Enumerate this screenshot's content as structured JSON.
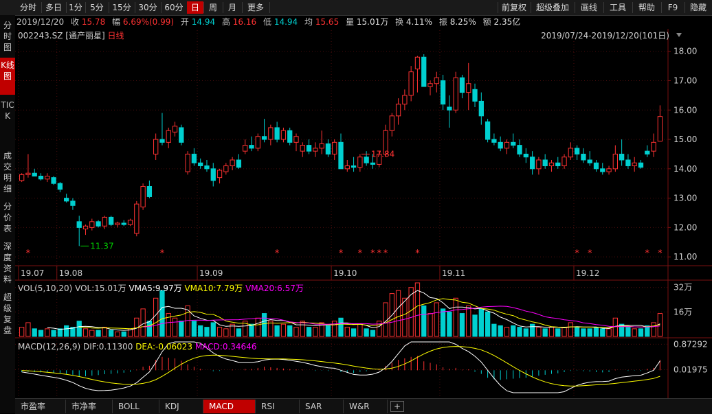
{
  "toolbar": {
    "periods": [
      "分时",
      "多日",
      "1分",
      "5分",
      "15分",
      "30分",
      "60分",
      "日",
      "周",
      "月",
      "更多"
    ],
    "active_period": "日",
    "right": [
      "前复权",
      "超级叠加",
      "画线",
      "工具",
      "帮助",
      "F9",
      "隐藏"
    ]
  },
  "info": {
    "date": "2019/12/20",
    "close_label": "收",
    "close": "15.78",
    "change_label": "幅",
    "change": "6.69%(0.99)",
    "open_label": "开",
    "open": "14.94",
    "high_label": "高",
    "high": "16.16",
    "low_label": "低",
    "low": "14.94",
    "avg_label": "均",
    "avg": "15.65",
    "vol_label": "量",
    "vol": "15.01万",
    "turnover_label": "换",
    "turnover": "4.11%",
    "amplitude_label": "振",
    "amplitude": "8.25%",
    "amount_label": "额",
    "amount": "2.35亿"
  },
  "sidebar": [
    "分时图",
    "K线图",
    "TICK",
    "成交明细",
    "分价表",
    "深度资料",
    "超级复盘"
  ],
  "sidebar_active": "K线图",
  "chart_header": {
    "code": "002243.SZ",
    "name": "[通产丽星]",
    "period": "日线",
    "range": "2019/07/24-2019/12/20(101日)"
  },
  "volume_header": {
    "title": "VOL(5,10,20)",
    "vol": "VOL:15.01万",
    "vma5": "VMA5:9.97万",
    "vma10": "VMA10:7.79万",
    "vma20": "VMA20:6.57万"
  },
  "macd_header": {
    "title": "MACD(12,26,9)",
    "dif": "DIF:0.11300",
    "dea": "DEA:-0.06023",
    "macd": "MACD:0.34646"
  },
  "bottom_tabs": [
    "市盈率",
    "市净率",
    "BOLL",
    "KDJ",
    "MACD",
    "RSI",
    "SAR",
    "W&R"
  ],
  "bottom_active": "MACD",
  "colors": {
    "up": "#ff3232",
    "down": "#00d0d0",
    "vma5": "#ffffff",
    "vma10": "#ffff00",
    "vma20": "#ff00ff",
    "dif": "#ffffff",
    "dea": "#ffff00"
  },
  "chart_data": {
    "type": "candlestick",
    "price_axis": {
      "ticks": [
        "18.00",
        "17.00",
        "16.00",
        "15.00",
        "14.00",
        "13.00",
        "12.00",
        "11.00"
      ],
      "ylim": [
        10.7,
        18.25
      ]
    },
    "x_ticks": [
      {
        "label": "19.07",
        "i": 0
      },
      {
        "label": "19.08",
        "i": 6
      },
      {
        "label": "19.09",
        "i": 28
      },
      {
        "label": "19.10",
        "i": 49
      },
      {
        "label": "19.11",
        "i": 66
      },
      {
        "label": "19.12",
        "i": 87
      }
    ],
    "annotations": [
      {
        "label": "17.84",
        "i": 53
      },
      {
        "label": "11.37",
        "i": 9
      }
    ],
    "star_indices": [
      1,
      22,
      40,
      50,
      53,
      55,
      56,
      57,
      62,
      87,
      89,
      98,
      100
    ],
    "volume_axis": {
      "ticks": [
        "32万",
        "16万"
      ],
      "max": 35
    },
    "macd_axis": {
      "ticks": [
        "0.87292",
        "0.01975"
      ],
      "range": [
        -0.75,
        0.95
      ]
    },
    "candles": [
      [
        13.6,
        13.85,
        13.55,
        13.8
      ],
      [
        13.8,
        14.5,
        13.7,
        13.85
      ],
      [
        13.85,
        14.0,
        13.75,
        13.75
      ],
      [
        13.75,
        13.85,
        13.6,
        13.65
      ],
      [
        13.65,
        13.85,
        13.55,
        13.75
      ],
      [
        13.7,
        13.75,
        13.45,
        13.5
      ],
      [
        13.5,
        13.55,
        13.2,
        13.3
      ],
      [
        13.0,
        13.15,
        12.85,
        12.9
      ],
      [
        12.9,
        13.0,
        12.6,
        12.75
      ],
      [
        12.2,
        12.4,
        11.37,
        12.0
      ],
      [
        11.95,
        12.1,
        11.75,
        12.05
      ],
      [
        12.0,
        12.3,
        11.9,
        12.2
      ],
      [
        12.2,
        12.25,
        12.0,
        12.05
      ],
      [
        12.05,
        12.4,
        11.95,
        12.35
      ],
      [
        12.35,
        12.4,
        12.05,
        12.1
      ],
      [
        12.1,
        12.2,
        12.0,
        12.15
      ],
      [
        12.15,
        12.25,
        12.05,
        12.1
      ],
      [
        12.1,
        12.3,
        12.05,
        12.25
      ],
      [
        11.8,
        12.9,
        11.7,
        12.8
      ],
      [
        12.7,
        13.5,
        12.6,
        13.4
      ],
      [
        13.4,
        13.6,
        13.0,
        13.05
      ],
      [
        14.5,
        15.2,
        14.3,
        15.0
      ],
      [
        15.0,
        15.9,
        14.8,
        14.9
      ],
      [
        14.9,
        15.4,
        14.7,
        15.3
      ],
      [
        15.25,
        15.6,
        15.1,
        15.45
      ],
      [
        15.4,
        15.5,
        14.8,
        14.9
      ],
      [
        13.9,
        14.6,
        13.8,
        14.5
      ],
      [
        14.5,
        14.7,
        14.1,
        14.2
      ],
      [
        14.2,
        14.35,
        14.0,
        14.1
      ],
      [
        14.1,
        14.3,
        13.9,
        14.0
      ],
      [
        14.0,
        14.2,
        13.4,
        13.6
      ],
      [
        13.7,
        14.0,
        13.5,
        13.95
      ],
      [
        13.9,
        14.2,
        13.8,
        14.1
      ],
      [
        14.1,
        14.4,
        13.95,
        14.3
      ],
      [
        14.3,
        14.5,
        14.0,
        14.05
      ],
      [
        14.6,
        15.0,
        14.5,
        14.8
      ],
      [
        14.8,
        15.1,
        14.6,
        14.7
      ],
      [
        14.7,
        15.2,
        14.6,
        15.1
      ],
      [
        15.1,
        15.7,
        14.9,
        15.0
      ],
      [
        15.0,
        15.5,
        14.8,
        15.4
      ],
      [
        15.4,
        15.6,
        14.9,
        15.0
      ],
      [
        15.0,
        15.4,
        14.9,
        15.3
      ],
      [
        15.3,
        15.4,
        14.8,
        14.9
      ],
      [
        14.9,
        15.2,
        14.6,
        15.1
      ],
      [
        14.6,
        14.9,
        14.4,
        14.8
      ],
      [
        14.8,
        15.0,
        14.5,
        14.6
      ],
      [
        14.6,
        14.9,
        14.4,
        14.7
      ],
      [
        14.7,
        15.3,
        14.5,
        14.85
      ],
      [
        14.85,
        15.0,
        14.4,
        14.5
      ],
      [
        14.5,
        15.0,
        14.3,
        14.9
      ],
      [
        14.9,
        15.2,
        14.4,
        14.0
      ],
      [
        14.0,
        14.3,
        13.9,
        14.1
      ],
      [
        14.1,
        14.4,
        13.9,
        14.05
      ],
      [
        14.05,
        14.5,
        13.9,
        14.4
      ],
      [
        14.4,
        14.6,
        14.1,
        14.2
      ],
      [
        14.2,
        14.5,
        14.0,
        14.15
      ],
      [
        14.15,
        14.6,
        14.05,
        14.5
      ],
      [
        14.5,
        15.5,
        14.4,
        15.3
      ],
      [
        15.3,
        15.9,
        15.1,
        15.8
      ],
      [
        15.8,
        16.4,
        15.5,
        16.2
      ],
      [
        16.2,
        16.7,
        16.0,
        16.5
      ],
      [
        16.5,
        17.5,
        16.3,
        17.3
      ],
      [
        17.4,
        17.84,
        16.6,
        17.8
      ],
      [
        17.8,
        17.9,
        16.8,
        16.8
      ],
      [
        16.8,
        17.0,
        16.5,
        16.9
      ],
      [
        16.9,
        17.3,
        16.6,
        17.1
      ],
      [
        17.0,
        17.2,
        16.0,
        16.2
      ],
      [
        16.1,
        16.5,
        15.4,
        16.0
      ],
      [
        16.0,
        17.3,
        15.9,
        17.1
      ],
      [
        17.1,
        17.2,
        16.4,
        16.6
      ],
      [
        16.6,
        17.6,
        16.0,
        16.9
      ],
      [
        16.7,
        16.9,
        16.1,
        16.3
      ],
      [
        16.3,
        16.6,
        15.5,
        15.8
      ],
      [
        15.6,
        15.7,
        14.9,
        15.0
      ],
      [
        15.0,
        15.2,
        14.8,
        14.9
      ],
      [
        14.9,
        15.1,
        14.6,
        14.7
      ],
      [
        14.7,
        15.0,
        14.5,
        14.9
      ],
      [
        14.9,
        15.2,
        14.7,
        14.8
      ],
      [
        14.8,
        15.0,
        14.4,
        14.5
      ],
      [
        14.5,
        14.7,
        14.2,
        14.4
      ],
      [
        14.4,
        14.6,
        13.8,
        14.0
      ],
      [
        14.0,
        14.4,
        13.8,
        14.3
      ],
      [
        14.3,
        14.5,
        14.0,
        14.1
      ],
      [
        14.1,
        14.3,
        13.9,
        14.2
      ],
      [
        14.2,
        14.4,
        14.0,
        14.1
      ],
      [
        14.1,
        14.5,
        14.0,
        14.4
      ],
      [
        14.4,
        14.9,
        14.3,
        14.7
      ],
      [
        14.7,
        14.8,
        14.3,
        14.5
      ],
      [
        14.5,
        14.7,
        14.2,
        14.3
      ],
      [
        14.3,
        14.6,
        14.1,
        14.2
      ],
      [
        14.2,
        14.3,
        13.9,
        14.0
      ],
      [
        14.0,
        14.2,
        13.8,
        13.9
      ],
      [
        13.9,
        14.1,
        13.8,
        14.0
      ],
      [
        14.0,
        14.8,
        13.9,
        14.5
      ],
      [
        14.5,
        15.0,
        14.1,
        14.3
      ],
      [
        14.3,
        14.5,
        14.0,
        14.1
      ],
      [
        14.1,
        14.4,
        13.9,
        14.2
      ],
      [
        14.2,
        14.3,
        14.0,
        14.05
      ],
      [
        14.6,
        14.8,
        14.4,
        14.5
      ],
      [
        14.6,
        15.2,
        14.4,
        14.9
      ],
      [
        14.94,
        16.16,
        14.94,
        15.78
      ]
    ],
    "volumes": [
      6,
      9,
      5,
      4,
      5,
      4,
      5,
      7,
      6,
      10,
      5,
      4,
      4,
      6,
      4,
      3,
      3,
      5,
      12,
      18,
      10,
      25,
      30,
      15,
      12,
      10,
      20,
      10,
      7,
      6,
      9,
      6,
      5,
      8,
      5,
      10,
      8,
      12,
      15,
      10,
      7,
      8,
      7,
      6,
      10,
      6,
      6,
      9,
      7,
      10,
      12,
      6,
      5,
      8,
      5,
      4,
      10,
      22,
      28,
      30,
      25,
      32,
      35,
      20,
      15,
      22,
      18,
      16,
      25,
      15,
      20,
      14,
      18,
      16,
      8,
      7,
      6,
      7,
      6,
      5,
      8,
      6,
      5,
      6,
      5,
      6,
      9,
      6,
      5,
      5,
      6,
      5,
      5,
      12,
      8,
      6,
      5,
      5,
      7,
      9,
      15
    ],
    "macd_bars": [
      -0.06,
      -0.05,
      -0.06,
      -0.07,
      -0.07,
      -0.08,
      -0.09,
      -0.12,
      -0.15,
      -0.2,
      -0.2,
      -0.18,
      -0.16,
      -0.13,
      -0.12,
      -0.1,
      -0.08,
      -0.05,
      0.02,
      0.12,
      0.15,
      0.35,
      0.45,
      0.42,
      0.4,
      0.32,
      0.2,
      0.12,
      0.05,
      0.0,
      -0.03,
      -0.02,
      0.0,
      0.02,
      0.0,
      0.05,
      0.05,
      0.08,
      0.12,
      0.1,
      0.08,
      0.06,
      0.04,
      0.03,
      0.02,
      0.0,
      -0.02,
      -0.01,
      -0.02,
      0.0,
      -0.06,
      -0.08,
      -0.09,
      -0.05,
      -0.03,
      0.0,
      0.05,
      0.15,
      0.25,
      0.35,
      0.4,
      0.45,
      0.48,
      0.3,
      0.25,
      0.2,
      0.1,
      0.05,
      0.08,
      0.02,
      0.03,
      -0.05,
      -0.12,
      -0.25,
      -0.3,
      -0.32,
      -0.3,
      -0.28,
      -0.26,
      -0.25,
      -0.22,
      -0.18,
      -0.15,
      -0.12,
      -0.1,
      -0.06,
      -0.02,
      -0.01,
      -0.03,
      -0.04,
      -0.06,
      -0.07,
      -0.06,
      0.02,
      0.0,
      -0.02,
      -0.01,
      -0.02,
      0.05,
      0.08,
      0.35
    ]
  }
}
